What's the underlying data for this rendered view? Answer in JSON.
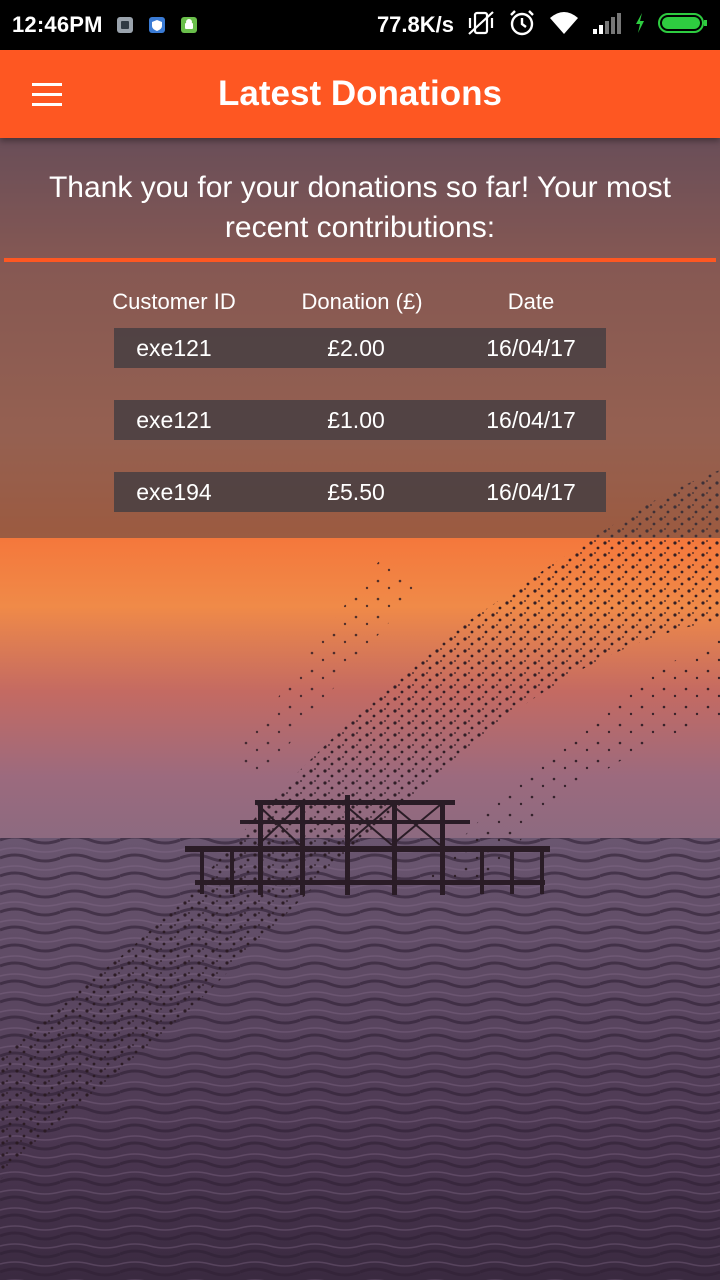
{
  "status_bar": {
    "time": "12:46PM",
    "network_speed": "77.8K/s",
    "icons": [
      "notification-app-icon",
      "shield-notification-icon",
      "android-notification-icon",
      "vibrate-off-icon",
      "alarm-icon",
      "wifi-icon",
      "signal-icon",
      "charging-icon",
      "battery-icon"
    ],
    "battery_color": "#2ecc40"
  },
  "app_bar": {
    "title": "Latest Donations",
    "menu_icon": "hamburger-menu-icon",
    "color": "#fe5722"
  },
  "content": {
    "intro_text": "Thank you for your donations so far! Your most recent contributions:",
    "table": {
      "headers": [
        "Customer ID",
        "Donation (£)",
        "Date"
      ],
      "rows": [
        {
          "customer_id": "exe121",
          "donation": "£2.00",
          "date": "16/04/17"
        },
        {
          "customer_id": "exe121",
          "donation": "£1.00",
          "date": "16/04/17"
        },
        {
          "customer_id": "exe194",
          "donation": "£5.50",
          "date": "16/04/17"
        }
      ]
    }
  },
  "background": {
    "description_colors": [
      "#e8704a",
      "#f06a3a",
      "#7a4a6a",
      "#3a2a3e"
    ]
  }
}
